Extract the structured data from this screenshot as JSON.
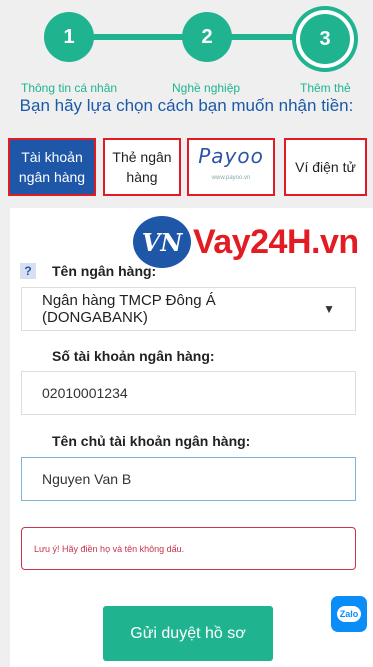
{
  "stepper": {
    "steps": [
      {
        "number": "1",
        "label": "Thông tin cá nhân"
      },
      {
        "number": "2",
        "label": "Nghề nghiệp"
      },
      {
        "number": "3",
        "label": "Thêm thẻ"
      }
    ],
    "active_step": 3,
    "accent_color": "#1fb48f"
  },
  "heading": "Bạn hãy lựa chọn cách bạn muốn nhận tiền:",
  "methods": {
    "bank_account": "Tài khoản ngân hàng",
    "bank_card": "Thẻ ngân hàng",
    "payoo": {
      "logo": "Payoo",
      "sub": "www.payoo.vn"
    },
    "e_wallet": "Ví điện tử",
    "selected": "bank_account"
  },
  "watermark": {
    "badge": "VN",
    "text": "Vay24H.vn"
  },
  "form": {
    "help_icon": "?",
    "bank_name_label": "Tên ngân hàng:",
    "bank_name_value": "Ngân hàng TMCP Đông Á (DONGABANK)",
    "account_number_label": "Số tài khoản ngân hàng:",
    "account_number_value": "02010001234",
    "holder_name_label": "Tên chủ tài khoản ngân hàng:",
    "holder_name_value": "Nguyen Van B",
    "notice": "Lưu ý! Hãy điền họ và tên không dấu."
  },
  "submit_label": "Gửi duyệt hồ sơ",
  "zalo_label": "Zalo"
}
